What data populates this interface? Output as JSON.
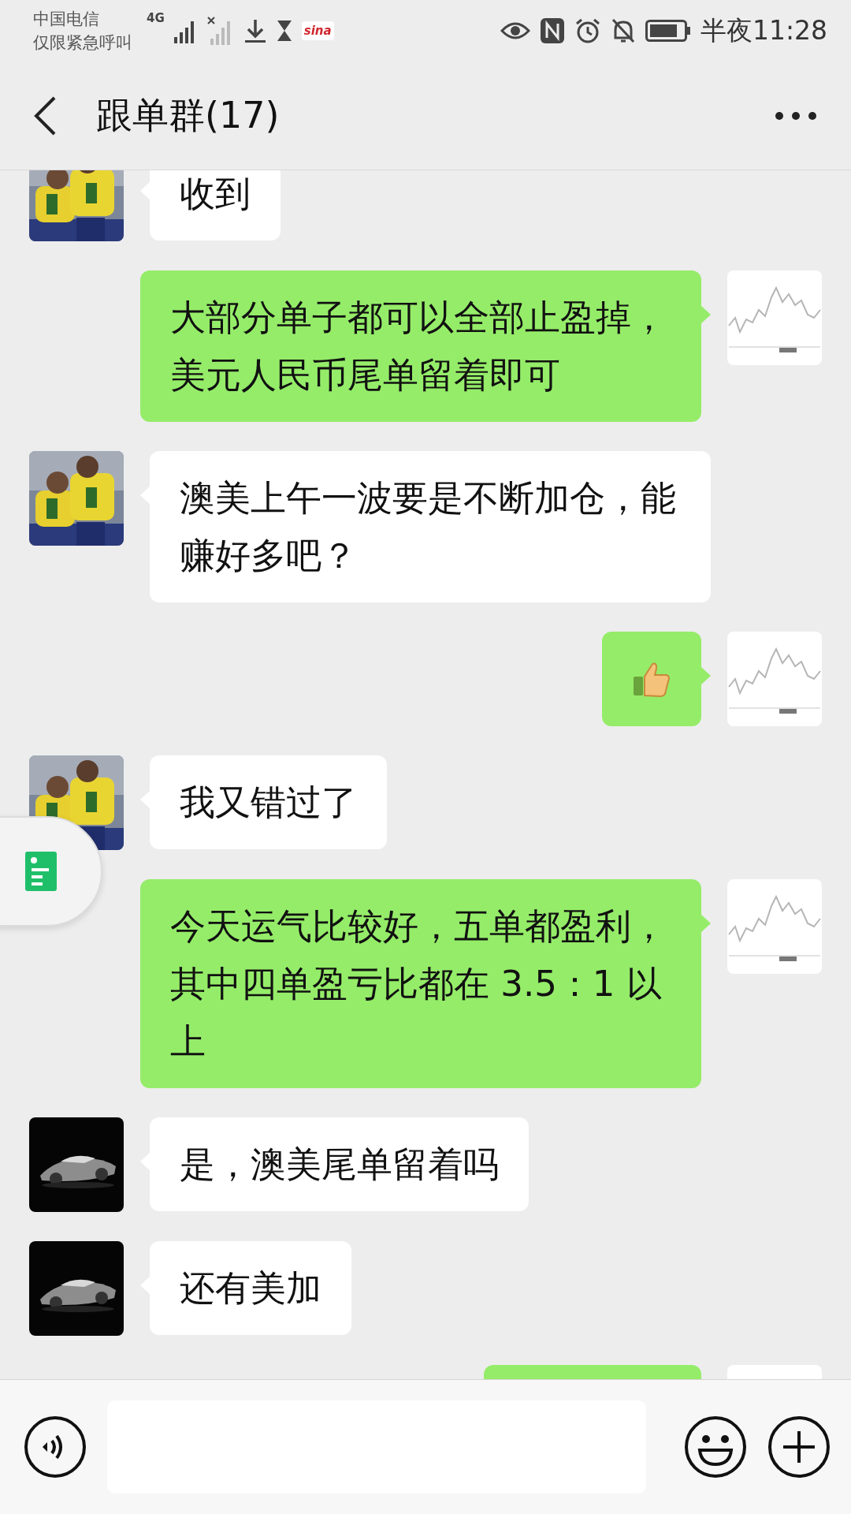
{
  "status_bar": {
    "carrier": "中国电信",
    "carrier_note": "仅限紧急呼叫",
    "network": "4G",
    "app_badge": "sina",
    "time": "半夜11:28"
  },
  "nav": {
    "title": "跟单群(17)"
  },
  "messages": [
    {
      "outgoing": false,
      "avatar": {
        "kind": "players"
      },
      "kind": "text",
      "text": "收到"
    },
    {
      "outgoing": true,
      "avatar": {
        "kind": "chart"
      },
      "kind": "text",
      "text": "大部分单子都可以全部止盈掉，美元人民币尾单留着即可"
    },
    {
      "outgoing": false,
      "avatar": {
        "kind": "players"
      },
      "kind": "text",
      "text": "澳美上午一波要是不断加仓，能赚好多吧？"
    },
    {
      "outgoing": true,
      "avatar": {
        "kind": "chart"
      },
      "kind": "thumbs-up"
    },
    {
      "outgoing": false,
      "avatar": {
        "kind": "players"
      },
      "kind": "text",
      "text": "我又错过了"
    },
    {
      "outgoing": true,
      "avatar": {
        "kind": "chart"
      },
      "kind": "text",
      "text": "今天运气比较好，五单都盈利，其中四单盈亏比都在 3.5：1 以上"
    },
    {
      "outgoing": false,
      "avatar": {
        "kind": "car"
      },
      "kind": "text",
      "text": "是，澳美尾单留着吗"
    },
    {
      "outgoing": false,
      "avatar": {
        "kind": "car"
      },
      "kind": "text",
      "text": "还有美加"
    },
    {
      "outgoing": true,
      "avatar": {
        "kind": "chart"
      },
      "kind": "cut"
    }
  ]
}
